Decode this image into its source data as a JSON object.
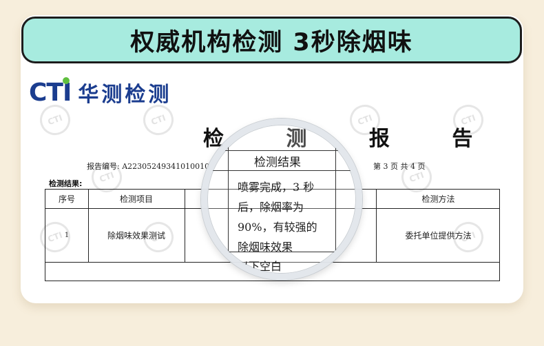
{
  "banner": {
    "title": "权威机构检测  3秒除烟味"
  },
  "logo": {
    "mark": "CTI",
    "name": "华测检测"
  },
  "watermark": {
    "text": "CTI"
  },
  "report": {
    "title": "检 测 报 告",
    "report_no": "报告编号: A22305249341010010",
    "page_info": "第 3 页 共 4 页",
    "section_label": "检测结果:"
  },
  "table": {
    "headers": [
      "序号",
      "检测项目",
      "检测结果",
      "检测方法"
    ],
    "rows": [
      {
        "index": "1",
        "item": "除烟味效果测试",
        "result": "喷雾完成, 3 秒后, 除烟率为90%, 有较强的除烟味效果",
        "method": "委托单位提供方法"
      }
    ],
    "footer": "以下空白"
  },
  "magnifier": {
    "header": "检测结果",
    "result_lines": [
      "喷雾完成，3 秒",
      "后，除烟率为",
      "90%，有较强的",
      "除烟味效果"
    ],
    "footer": "以下空白"
  }
}
